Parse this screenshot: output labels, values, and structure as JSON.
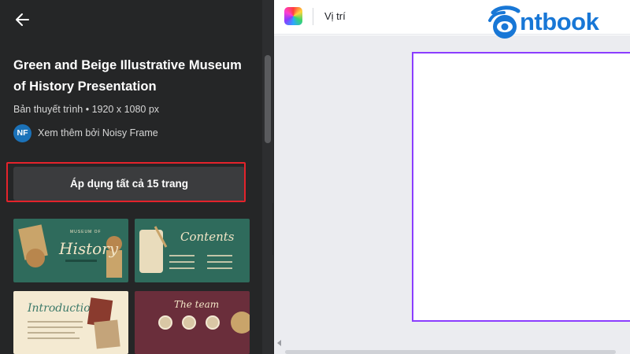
{
  "panel": {
    "title": "Green and Beige Illustrative Museum of History Presentation",
    "meta": "Bản thuyết trình • 1920 x 1080 px",
    "author_initials": "NF",
    "author_link": "Xem thêm bởi Noisy Frame",
    "apply_label": "Áp dụng tất cả 15 trang",
    "thumbnails": [
      {
        "title": "History",
        "small": "MUSEUM OF"
      },
      {
        "title": "Contents"
      },
      {
        "title": "Introduction"
      },
      {
        "title": "The team"
      }
    ]
  },
  "topbar": {
    "position_label": "Vị trí"
  },
  "logo": {
    "text": "ntbook"
  },
  "colors": {
    "panel_bg": "#252627",
    "accent": "#8b3dff",
    "highlight": "#e4232b",
    "logo": "#1877d6"
  },
  "icons": [
    "back-arrow-icon",
    "color-palette-icon",
    "chevron-left-icon"
  ]
}
